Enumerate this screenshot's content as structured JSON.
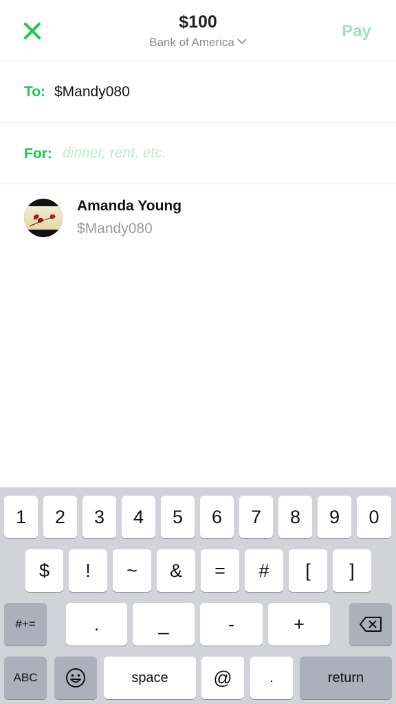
{
  "header": {
    "close_icon": "close-icon",
    "amount": "$100",
    "source": "Bank of America",
    "source_chevron_icon": "chevron-down-icon",
    "pay_label": "Pay",
    "accent_color": "#1ec84f"
  },
  "to_field": {
    "label": "To:",
    "value": "$Mandy080"
  },
  "for_field": {
    "label": "For:",
    "placeholder": "dinner, rent, etc."
  },
  "contact": {
    "name": "Amanda Young",
    "handle": "$Mandy080"
  },
  "keyboard": {
    "row1": [
      "1",
      "2",
      "3",
      "4",
      "5",
      "6",
      "7",
      "8",
      "9",
      "0"
    ],
    "row2": [
      "$",
      "!",
      "~",
      "&",
      "=",
      "#",
      "[",
      "]"
    ],
    "row3": {
      "shift_label": "#+=",
      "keys": [
        ".",
        "_",
        "-",
        "+"
      ],
      "delete_icon": "backspace-icon"
    },
    "row4": {
      "abc_label": "ABC",
      "emoji_icon": "emoji-icon",
      "space_label": "space",
      "at": "@",
      "dot": ".",
      "return_label": "return"
    }
  }
}
